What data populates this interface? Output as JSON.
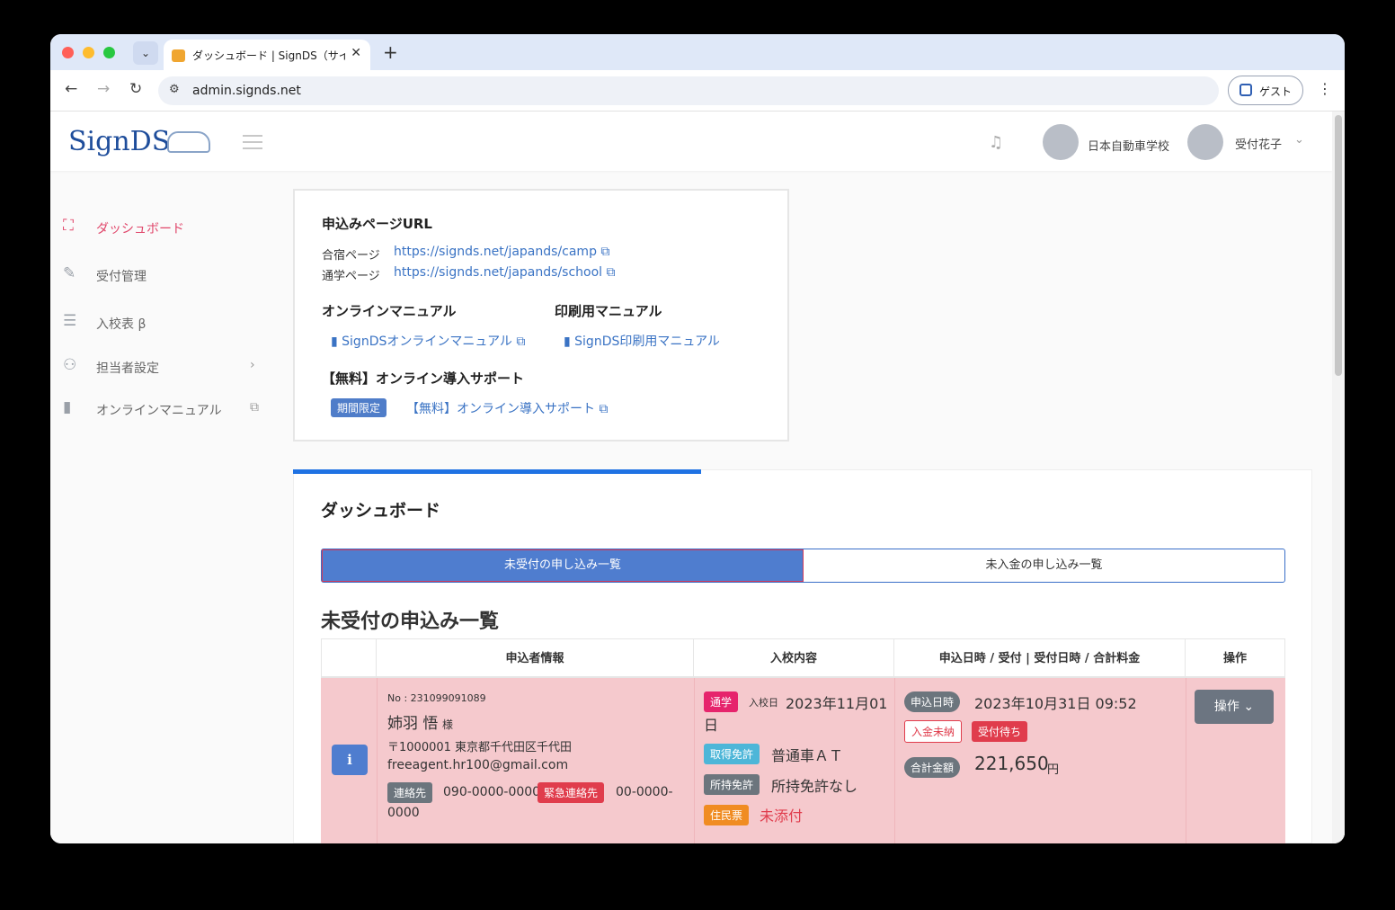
{
  "browser": {
    "tab_title": "ダッシュボード | SignDS（サイ",
    "tab_close": "✕",
    "new_tab": "+",
    "url": "admin.signds.net",
    "guest_label": "ゲスト",
    "back": "←",
    "forward": "→",
    "reload": "↻",
    "dropdown": "⌄",
    "menu": "⋮"
  },
  "header": {
    "logo": "SignDS",
    "school_name": "日本自動車学校",
    "user_name": "受付花子",
    "user_chevron": "⌄",
    "bell_icon": "🔔"
  },
  "sidebar": {
    "items": [
      {
        "label": "ダッシュボード",
        "icon": "chart-icon",
        "glyph": "⛶"
      },
      {
        "label": "受付管理",
        "icon": "edit-icon",
        "glyph": "✎"
      },
      {
        "label": "入校表 β",
        "icon": "list-icon",
        "glyph": "☰"
      },
      {
        "label": "担当者設定",
        "icon": "user-icon",
        "glyph": "⚇",
        "right": "›"
      },
      {
        "label": "オンラインマニュアル",
        "icon": "book-icon",
        "glyph": "▮",
        "right": "⧉"
      }
    ]
  },
  "url_card": {
    "title": "申込みページURL",
    "camp_label": "合宿ページ",
    "camp_url": "https://signds.net/japands/camp ⧉",
    "school_label": "通学ページ",
    "school_url": "https://signds.net/japands/school ⧉",
    "online_manual_title": "オンラインマニュアル",
    "online_manual_link": "▮ SignDSオンラインマニュアル ⧉",
    "print_manual_title": "印刷用マニュアル",
    "print_manual_link": "▮ SignDS印刷用マニュアル",
    "support_title": "【無料】オンライン導入サポート",
    "support_badge": "期間限定",
    "support_link": "【無料】オンライン導入サポート ⧉"
  },
  "dashboard": {
    "title": "ダッシュボード",
    "tab_unreceived": "未受付の申し込み一覧",
    "tab_unpaid": "未入金の申し込み一覧",
    "list_title": "未受付の申込み一覧",
    "columns": [
      "",
      "申込者情報",
      "入校内容",
      "申込日時 / 受付 | 受付日時 / 合計料金",
      "操作"
    ],
    "row": {
      "info_icon": "i",
      "number": "No : 231099091089",
      "name": "姉羽 悟",
      "honorific": "様",
      "address": "〒1000001 東京都千代田区千代田",
      "email": "freeagent.hr100@gmail.com",
      "contact_tag": "連絡先",
      "contact": "090-0000-0000",
      "emergency_tag": "緊急連絡先",
      "emergency_1": "00-0000-",
      "emergency_2": "0000",
      "type_tag": "通学",
      "entry_label": "入校日",
      "entry_date_1": "2023年11月01",
      "entry_date_2": "日",
      "license_tag": "取得免許",
      "license": "普通車ＡＴ",
      "held_tag": "所持免許",
      "held": "所持免許なし",
      "resident_tag": "住民票",
      "resident": "未添付",
      "applied_tag": "申込日時",
      "applied": "2023年10月31日 09:52",
      "unpaid_tag": "入金未納",
      "waiting_tag": "受付待ち",
      "total_tag": "合計金額",
      "total": "221,650",
      "yen": "円",
      "op_button": "操作 ⌄"
    }
  }
}
